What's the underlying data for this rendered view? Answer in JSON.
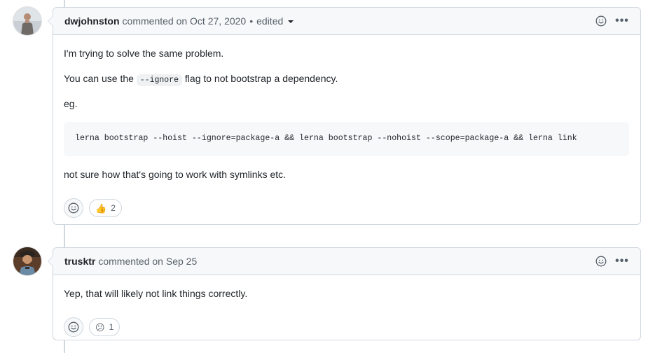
{
  "comments": [
    {
      "author": "dwjohnston",
      "action": "commented on Oct 27, 2020",
      "separator": "•",
      "edited_label": "edited",
      "body": {
        "p1": "I'm trying to solve the same problem.",
        "p2_before": "You can use the ",
        "p2_code": "--ignore",
        "p2_after": " flag to not bootstrap a dependency.",
        "p3": "eg.",
        "code_block": "lerna bootstrap --hoist --ignore=package-a && lerna bootstrap --nohoist --scope=package-a && lerna link",
        "p4": "not sure how that's going to work with symlinks etc."
      },
      "reaction": {
        "emoji": "👍",
        "count": "2"
      }
    },
    {
      "author": "trusktr",
      "action": "commented on Sep 25",
      "body": {
        "p1": "Yep, that will likely not link things correctly."
      },
      "reaction": {
        "emoji": "😕",
        "count": "1"
      }
    }
  ],
  "icons": {
    "smiley": "smiley-icon",
    "kebab": "kebab-horizontal-icon",
    "kebab_glyph": "•••"
  },
  "colors": {
    "border": "#d0d7de",
    "header_bg": "#f6f8fa",
    "text": "#1f2328",
    "muted": "#57606a"
  }
}
